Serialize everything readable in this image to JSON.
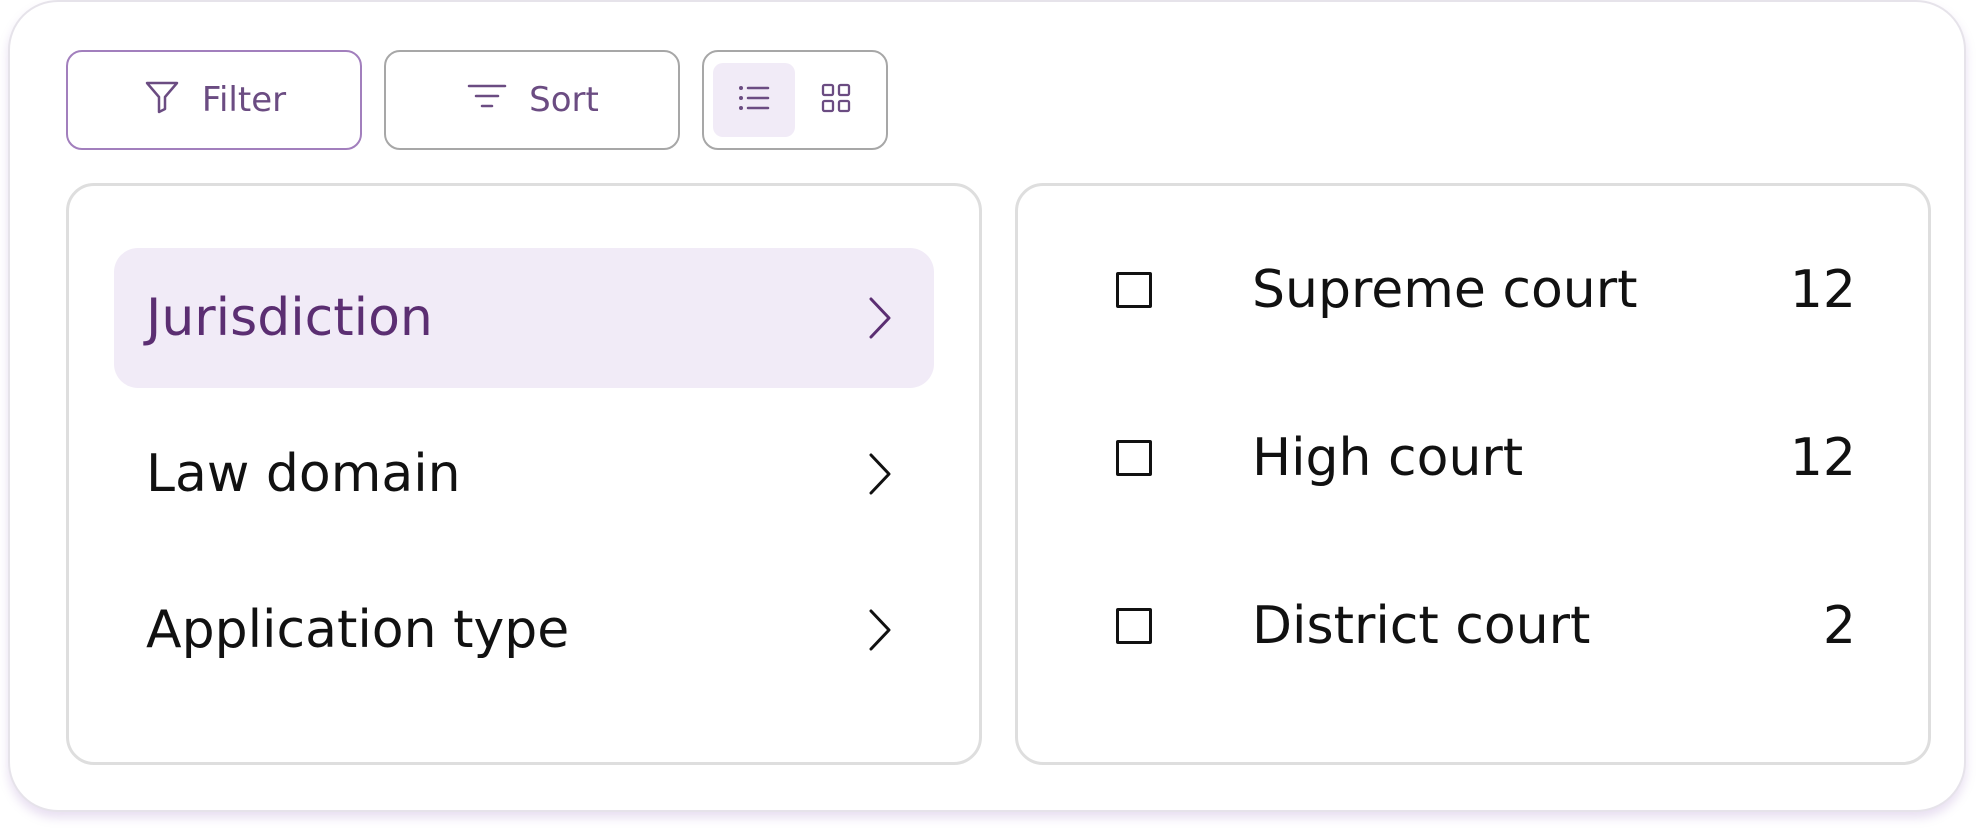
{
  "toolbar": {
    "filter_label": "Filter",
    "sort_label": "Sort",
    "view_modes": [
      "list-icon",
      "grid-icon"
    ],
    "active_view": "list"
  },
  "categories": [
    {
      "label": "Jurisdiction",
      "active": true
    },
    {
      "label": "Law domain",
      "active": false
    },
    {
      "label": "Application type",
      "active": false
    }
  ],
  "options": [
    {
      "label": "Supreme court",
      "count": "12",
      "checked": false
    },
    {
      "label": "High court",
      "count": "12",
      "checked": false
    },
    {
      "label": "District court",
      "count": "2",
      "checked": false
    }
  ],
  "colors": {
    "accent": "#5b2e72",
    "accent_light": "#f1ebf7",
    "accent_border": "#a27fbd"
  }
}
